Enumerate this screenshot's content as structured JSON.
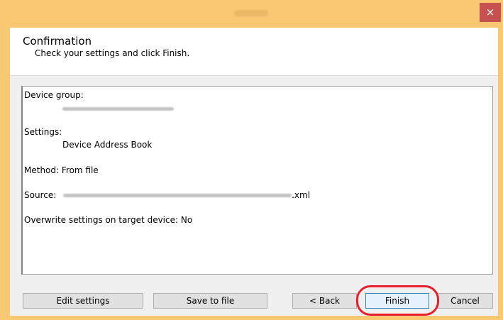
{
  "window": {
    "title": "",
    "close_glyph": "×",
    "title_bar_color": "#f9c873",
    "close_color": "#c75050"
  },
  "header": {
    "title": "Confirmation",
    "subtitle": "Check your settings and click Finish."
  },
  "summary": {
    "device_group_label": "Device group:",
    "settings_label": "Settings:",
    "settings_value": "Device Address Book",
    "method": "Method: From file",
    "source_label": "Source:",
    "source_suffix": ".xml",
    "overwrite": "Overwrite settings on target device: No"
  },
  "buttons": {
    "edit_settings": "Edit settings",
    "save_to_file": "Save to file",
    "back": "< Back",
    "finish": "Finish",
    "cancel": "Cancel"
  },
  "highlight_color": "#e8202a"
}
